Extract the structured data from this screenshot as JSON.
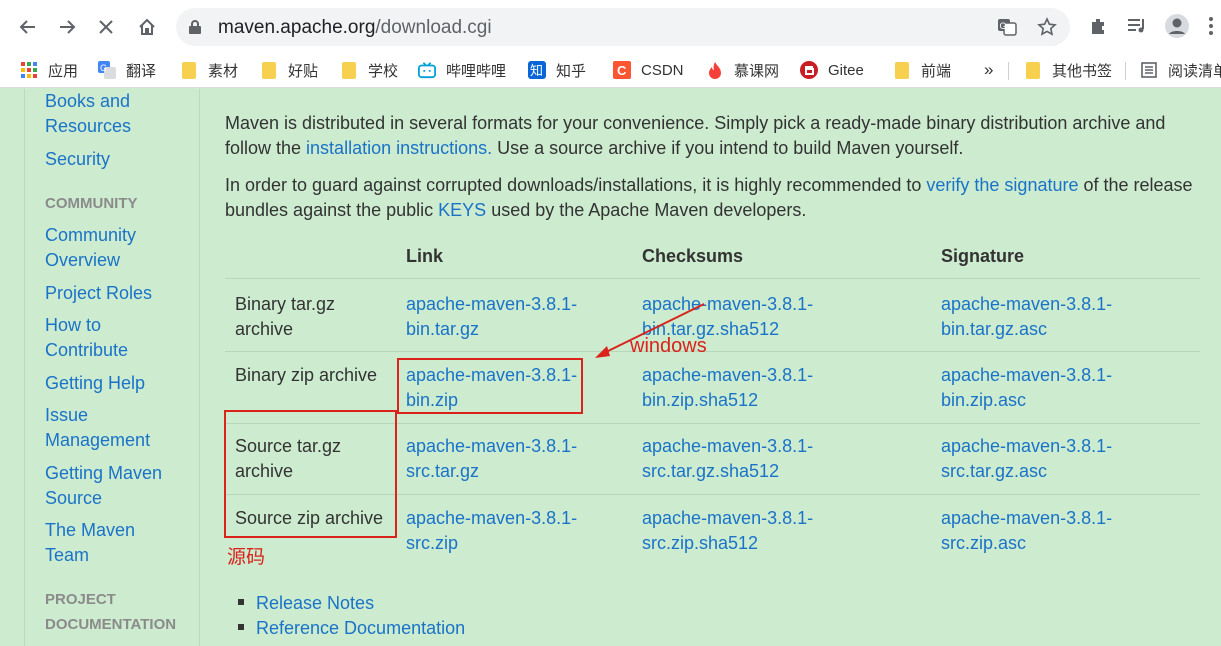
{
  "browser": {
    "url_host": "maven.apache.org",
    "url_path": "/download.cgi",
    "bookmarks": [
      "应用",
      "翻译",
      "素材",
      "好贴",
      "学校",
      "哔哩哔哩",
      "知乎",
      "CSDN",
      "慕课网",
      "Gitee",
      "前端",
      "其他书签",
      "阅读清单"
    ],
    "overflow_label": "»"
  },
  "sidebar": {
    "items_top": [
      {
        "label": "Books and Resources"
      },
      {
        "label": "Security"
      }
    ],
    "community_heading": "COMMUNITY",
    "community_items": [
      {
        "label": "Community Overview"
      },
      {
        "label": "Project Roles"
      },
      {
        "label": "How to Contribute"
      },
      {
        "label": "Getting Help"
      },
      {
        "label": "Issue Management"
      },
      {
        "label": "Getting Maven Source"
      },
      {
        "label": "The Maven Team"
      }
    ],
    "project_heading": "PROJECT DOCUMENTATION"
  },
  "intro": {
    "p1_a": "Maven is distributed in several formats for your convenience. Simply pick a ready-made binary distribution archive and follow the ",
    "p1_link": "installation instructions.",
    "p1_b": " Use a source archive if you intend to build Maven yourself.",
    "p2_a": "In order to guard against corrupted downloads/installations, it is highly recommended to ",
    "p2_link1": "verify the signature",
    "p2_b": " of the release bundles against the public ",
    "p2_link2": "KEYS",
    "p2_c": " used by the Apache Maven developers."
  },
  "table": {
    "headers": {
      "link": "Link",
      "checksums": "Checksums",
      "signature": "Signature"
    },
    "rows": [
      {
        "name": "Binary tar.gz archive",
        "link": "apache-maven-3.8.1-bin.tar.gz",
        "checksum": "apache-maven-3.8.1-bin.tar.gz.sha512",
        "signature": "apache-maven-3.8.1-bin.tar.gz.asc"
      },
      {
        "name": "Binary zip archive",
        "link": "apache-maven-3.8.1-bin.zip",
        "checksum": "apache-maven-3.8.1-bin.zip.sha512",
        "signature": "apache-maven-3.8.1-bin.zip.asc"
      },
      {
        "name": "Source tar.gz archive",
        "link": "apache-maven-3.8.1-src.tar.gz",
        "checksum": "apache-maven-3.8.1-src.tar.gz.sha512",
        "signature": "apache-maven-3.8.1-src.tar.gz.asc"
      },
      {
        "name": "Source zip archive",
        "link": "apache-maven-3.8.1-src.zip",
        "checksum": "apache-maven-3.8.1-src.zip.sha512",
        "signature": "apache-maven-3.8.1-src.zip.asc"
      }
    ]
  },
  "annotations": {
    "windows": "windows",
    "source": "源码",
    "color": "#d9231b"
  },
  "links": [
    "Release Notes",
    "Reference Documentation"
  ]
}
